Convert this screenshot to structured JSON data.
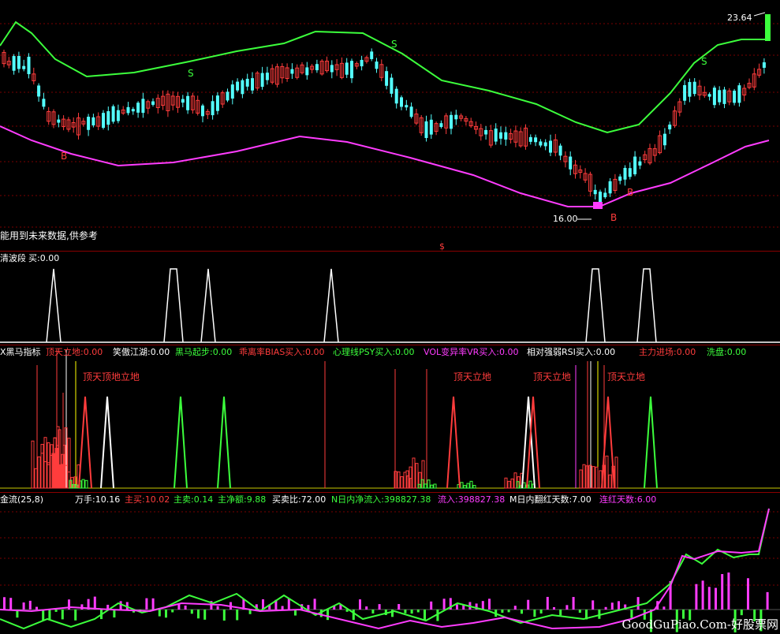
{
  "main": {
    "price_high": "23.64",
    "price_low": "16.00",
    "note": "能用到未来数据,供参考",
    "marker": "$",
    "signals": [
      {
        "text": "S",
        "pos": "upper"
      },
      {
        "text": "S",
        "pos": "upper"
      },
      {
        "text": "S",
        "pos": "upper"
      },
      {
        "text": "B",
        "pos": "lower"
      },
      {
        "text": "B",
        "pos": "lower"
      },
      {
        "text": "B",
        "pos": "lower"
      }
    ],
    "colors": {
      "bull": "#ff3c3c",
      "bear": "#54ffff",
      "band_upper": "#3cff3c",
      "band_lower": "#ff3cff",
      "signal_s": "#3cff3c",
      "signal_b": "#ff3c3c"
    }
  },
  "panel1": {
    "name": "清波段",
    "buy_label": "买:0.00"
  },
  "panel2": {
    "name": "X黑马指标",
    "fields": [
      {
        "text": "顶天立地:0.00",
        "color": "#ff3c3c"
      },
      {
        "text": "笑傲江湖:0.00",
        "color": "#ffffff"
      },
      {
        "text": "黑马起步:0.00",
        "color": "#3cff3c"
      },
      {
        "text": "乖离率BIAS买入:0.00",
        "color": "#ff3c3c"
      },
      {
        "text": "心理线PSY买入:0.00",
        "color": "#3cff3c"
      },
      {
        "text": "VOL变异率VR买入:0.00",
        "color": "#ff3cff"
      },
      {
        "text": "相对强弱RSI买入:0.00",
        "color": "#ffffff"
      },
      {
        "text": "主力进场:0.00",
        "color": "#ff3c3c"
      },
      {
        "text": "洗盘:0.00",
        "color": "#3cff3c"
      }
    ],
    "annotations": [
      "顶天顶地立地",
      "顶天立地",
      "顶天立地",
      "顶天立地"
    ]
  },
  "panel3": {
    "name": "金流(25,8)",
    "fields": [
      {
        "text": "万手:10.16",
        "color": "#ffffff"
      },
      {
        "text": "主买:10.02",
        "color": "#ff3c3c"
      },
      {
        "text": "主卖:0.14",
        "color": "#3cff3c"
      },
      {
        "text": "主净额:9.88",
        "color": "#3cff3c"
      },
      {
        "text": "买卖比:72.00",
        "color": "#ffffff"
      },
      {
        "text": "N日内净流入:398827.38",
        "color": "#3cff3c"
      },
      {
        "text": "流入:398827.38",
        "color": "#ff3cff"
      },
      {
        "text": "M日内翻红天数:7.00",
        "color": "#ffffff"
      },
      {
        "text": "连红天数:6.00",
        "color": "#ff3cff"
      }
    ]
  },
  "watermark": "GoodGuPiao.Com-好股票网"
}
